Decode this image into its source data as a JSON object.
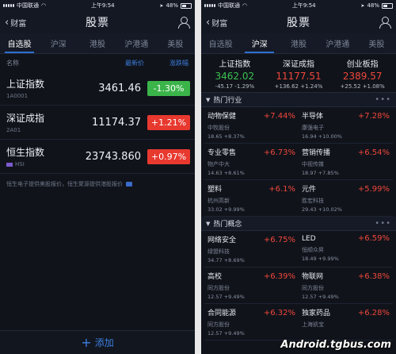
{
  "status": {
    "carrier": "中国联通",
    "time": "上午9:54",
    "battery": "48%"
  },
  "nav": {
    "back_label": "财富",
    "title": "股票"
  },
  "tabs": [
    "自选股",
    "沪深",
    "港股",
    "沪港通",
    "美股"
  ],
  "p1": {
    "headers": {
      "name": "名称",
      "price": "最新价",
      "change": "涨跌幅"
    },
    "rows": [
      {
        "name": "上证指数",
        "code": "1A0001",
        "price": "3461.46",
        "change": "-1.30%",
        "dir": "down"
      },
      {
        "name": "深证成指",
        "code": "2A01",
        "price": "11174.37",
        "change": "+1.21%",
        "dir": "up"
      },
      {
        "name": "恒生指数",
        "code": "HSI",
        "price": "23743.860",
        "change": "+0.97%",
        "dir": "up"
      }
    ],
    "notice": "恒生电子提供美股报价，恒生聚源提供港股报价",
    "add_label": "添加"
  },
  "p2": {
    "indices": [
      {
        "name": "上证指数",
        "value": "3462.02",
        "diff": "-45.17",
        "pct": "-1.29%",
        "dir": "down"
      },
      {
        "name": "深证成指",
        "value": "11177.51",
        "diff": "+136.62",
        "pct": "+1.24%",
        "dir": "up"
      },
      {
        "name": "创业板指",
        "value": "2389.57",
        "diff": "+25.52",
        "pct": "+1.08%",
        "dir": "up"
      }
    ],
    "sections": [
      {
        "title": "热门行业",
        "items": [
          {
            "name": "动物保健",
            "pct": "+7.44%",
            "stock": "中牧股份",
            "quote": "18.65 +8.37%"
          },
          {
            "name": "半导体",
            "pct": "+7.28%",
            "stock": "康强电子",
            "quote": "16.94 +10.00%"
          },
          {
            "name": "专业零售",
            "pct": "+6.73%",
            "stock": "物产中大",
            "quote": "14.63 +8.61%"
          },
          {
            "name": "营销传播",
            "pct": "+6.54%",
            "stock": "中视传媒",
            "quote": "18.97 +7.85%"
          },
          {
            "name": "塑料",
            "pct": "+6.1%",
            "stock": "杭州高新",
            "quote": "33.02 +9.99%"
          },
          {
            "name": "元件",
            "pct": "+5.99%",
            "stock": "胜宏科技",
            "quote": "29.43 +10.02%"
          }
        ]
      },
      {
        "title": "热门概念",
        "items": [
          {
            "name": "网络安全",
            "pct": "+6.75%",
            "stock": "绿盟科技",
            "quote": "34.77 +8.69%"
          },
          {
            "name": "LED",
            "pct": "+6.59%",
            "stock": "恒顺众昇",
            "quote": "18.49 +9.99%"
          },
          {
            "name": "高校",
            "pct": "+6.39%",
            "stock": "同方股份",
            "quote": "12.57 +9.49%"
          },
          {
            "name": "物联网",
            "pct": "+6.38%",
            "stock": "同方股份",
            "quote": "12.57 +9.49%"
          },
          {
            "name": "合同能源",
            "pct": "+6.32%",
            "stock": "同方股份",
            "quote": "12.57 +9.49%"
          },
          {
            "name": "独家药品",
            "pct": "+6.28%",
            "stock": "上海凯宝",
            "quote": ""
          }
        ]
      }
    ],
    "more": "•••"
  },
  "watermark": "Android.tgbus.com",
  "colors": {
    "accent": "#2f6fd0",
    "up": "#e8392f",
    "down": "#3bb44a"
  }
}
